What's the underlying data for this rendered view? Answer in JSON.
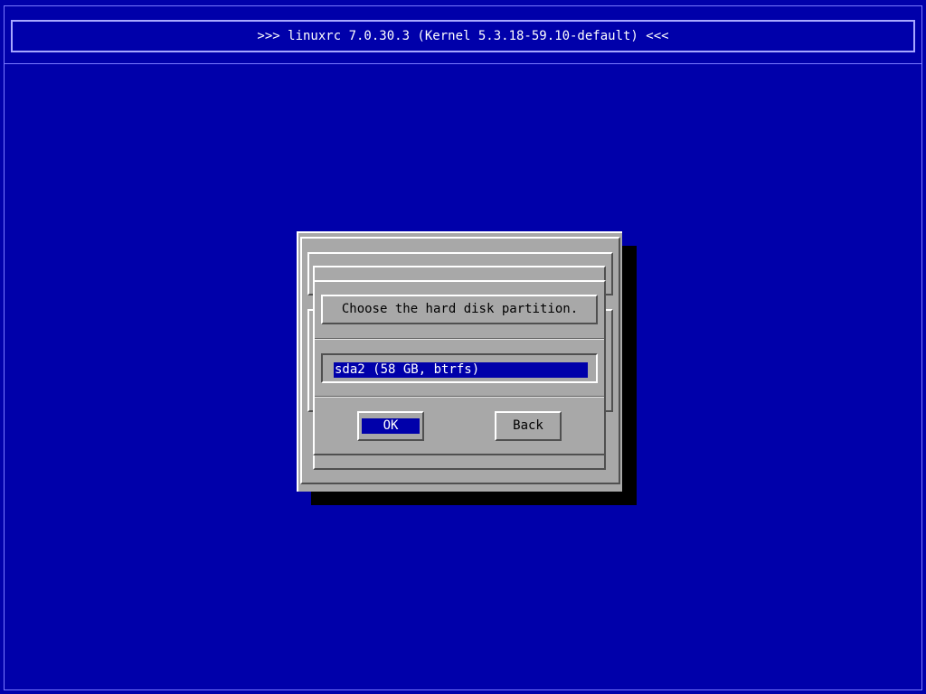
{
  "header": {
    "title": ">>> linuxrc 7.0.30.3 (Kernel 5.3.18-59.10-default) <<<"
  },
  "dialog": {
    "prompt": "Choose the hard disk partition.",
    "items": [
      {
        "label": "sda2 (58 GB, btrfs)",
        "selected": true
      }
    ],
    "ok_label": "OK",
    "back_label": "Back"
  },
  "colors": {
    "background": "#0000aa",
    "dialog": "#a8a8a8",
    "highlight": "#0000aa",
    "shadow": "#000000"
  }
}
